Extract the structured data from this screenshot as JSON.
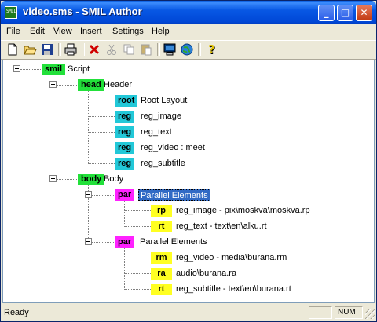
{
  "window": {
    "title": "video.sms - SMIL Author",
    "app_icon_text": "SMIL",
    "buttons": {
      "minimize": "_",
      "maximize": "□",
      "close": "✕"
    }
  },
  "menu": [
    {
      "label": "File"
    },
    {
      "label": "Edit"
    },
    {
      "label": "View"
    },
    {
      "label": "Insert"
    },
    {
      "label": "Settings"
    },
    {
      "label": "Help"
    }
  ],
  "toolbar_icons": [
    "new-file-icon",
    "open-folder-icon",
    "save-icon",
    "print-icon",
    "delete-icon",
    "cut-icon",
    "copy-icon",
    "paste-icon",
    "properties-icon",
    "preview-icon",
    "help-icon"
  ],
  "tree": {
    "root": {
      "tag": "smil",
      "label": "Script"
    },
    "head": {
      "tag": "head",
      "label": "Header"
    },
    "head_children": [
      {
        "tag": "root",
        "label": "Root Layout"
      },
      {
        "tag": "reg",
        "label": "reg_image"
      },
      {
        "tag": "reg",
        "label": "reg_text"
      },
      {
        "tag": "reg",
        "label": "reg_video : meet"
      },
      {
        "tag": "reg",
        "label": "reg_subtitle"
      }
    ],
    "body": {
      "tag": "body",
      "label": "Body"
    },
    "par1": {
      "tag": "par",
      "label": "Parallel Elements"
    },
    "par1_children": [
      {
        "tag": "rp",
        "label": "reg_image - pix\\moskva\\moskva.rp"
      },
      {
        "tag": "rt",
        "label": "reg_text - text\\en\\alku.rt"
      }
    ],
    "par2": {
      "tag": "par",
      "label": "Parallel Elements"
    },
    "par2_children": [
      {
        "tag": "rm",
        "label": "reg_video - media\\burana.rm"
      },
      {
        "tag": "ra",
        "label": "audio\\burana.ra"
      },
      {
        "tag": "rt",
        "label": "reg_subtitle - text\\en\\burana.rt"
      }
    ]
  },
  "colors": {
    "smil_tag": "#22e03a",
    "head_tag": "#22c8d8",
    "par_tag": "#ff22ff",
    "media_tag": "#ffff22",
    "selection": "#316ac5"
  },
  "statusbar": {
    "text": "Ready",
    "num": "NUM"
  }
}
